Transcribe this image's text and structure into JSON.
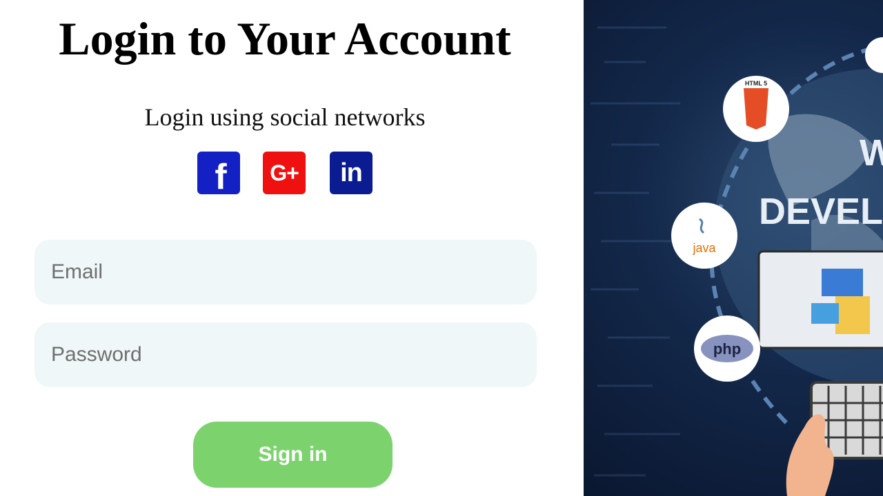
{
  "login": {
    "title": "Login to Your Account",
    "social_prompt": "Login using social networks",
    "social": {
      "facebook_glyph": "f",
      "google_glyph": "G+",
      "linkedin_glyph": "in"
    },
    "email_placeholder": "Email",
    "password_placeholder": "Password",
    "signin_label": "Sign in"
  },
  "hero": {
    "lines": [
      "W",
      "DEVEL"
    ],
    "badges": [
      "HTML 5",
      "java",
      "php"
    ]
  },
  "colors": {
    "facebook": "#1320c4",
    "google": "#ef1010",
    "linkedin": "#0b1c93",
    "signin": "#7cd36d",
    "field_bg": "#eff7f8"
  }
}
